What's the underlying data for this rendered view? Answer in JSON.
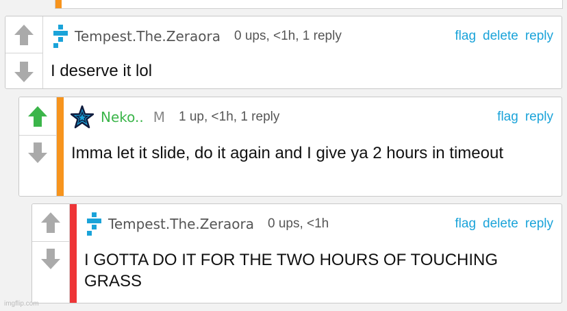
{
  "colors": {
    "link": "#1aa3d9",
    "reply_stripe_mod": "#f7941d",
    "reply_stripe_top": "#f7941d",
    "reply_stripe_third": "#ee3537",
    "upvoted": "#3bb54a",
    "arrow_gray": "#aaaaaa"
  },
  "comments": [
    {
      "username": "Tempest.The.Zeraora",
      "meta": "0 ups, <1h, 1 reply",
      "actions": [
        "flag",
        "delete",
        "reply"
      ],
      "text": "I deserve it lol",
      "avatar": "blue-plus-icon",
      "upvoted": false
    },
    {
      "username": "Neko..",
      "badge": "M",
      "meta": "1 up, <1h, 1 reply",
      "actions": [
        "flag",
        "reply"
      ],
      "text": "Imma let it slide, do it again and I give ya 2 hours in timeout",
      "avatar": "star-icon",
      "upvoted": true
    },
    {
      "username": "Tempest.The.Zeraora",
      "meta": "0 ups, <1h",
      "actions": [
        "flag",
        "delete",
        "reply"
      ],
      "text": "I GOTTA DO IT FOR THE TWO HOURS OF TOUCHING GRASS",
      "avatar": "blue-plus-icon",
      "upvoted": false
    }
  ],
  "watermark": "imgflip.com"
}
